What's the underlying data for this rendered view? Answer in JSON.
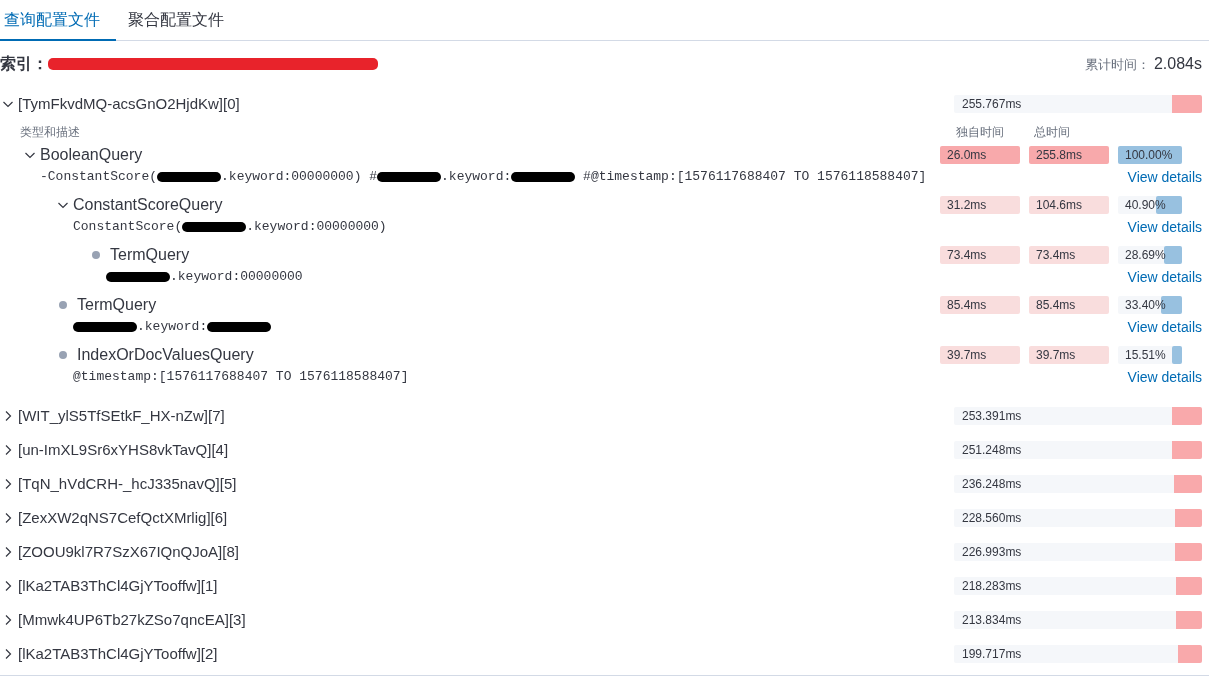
{
  "tabs": [
    {
      "label": "查询配置文件",
      "selected": true
    },
    {
      "label": "聚合配置文件",
      "selected": false
    }
  ],
  "index": {
    "label": "索引：",
    "value": [
      {
        "kind": "redaction",
        "color": "#e8232b"
      }
    ]
  },
  "cumulative": {
    "label": "累计时间：",
    "value": "2.084s"
  },
  "shards": [
    {
      "name": "[TymFkvdMQ-acsGnO2HjdKw][0]",
      "expanded": true,
      "time": "255.767ms",
      "level": 0.123,
      "columns": {
        "type": "类型和描述",
        "self": "独自时间",
        "total": "总时间"
      },
      "queries": [
        {
          "type": "BooleanQuery",
          "expanded": true,
          "description": [
            {
              "kind": "text",
              "text": "-ConstantScore("
            },
            {
              "kind": "redaction",
              "color": "#000000"
            },
            {
              "kind": "text",
              "text": ".keyword:00000000) #"
            },
            {
              "kind": "redaction",
              "color": "#000000"
            },
            {
              "kind": "text",
              "text": ".keyword:"
            },
            {
              "kind": "redaction",
              "color": "#000000"
            },
            {
              "kind": "text",
              "text": " #@timestamp:[1576117688407 TO 1576118588407]"
            }
          ],
          "self_time": {
            "text": "26.0ms",
            "color": "#f8a9ab"
          },
          "total_time": {
            "text": "255.8ms",
            "color": "#f8a9ab"
          },
          "percent": "100.00%",
          "level": 1,
          "link": "View details",
          "children": [
            {
              "type": "ConstantScoreQuery",
              "expanded": true,
              "description": [
                {
                  "kind": "text",
                  "text": "ConstantScore("
                },
                {
                  "kind": "redaction",
                  "color": "#000000"
                },
                {
                  "kind": "text",
                  "text": ".keyword:00000000)"
                }
              ],
              "self_time": {
                "text": "31.2ms",
                "color": "#f9dddd"
              },
              "total_time": {
                "text": "104.6ms",
                "color": "#f9dddd"
              },
              "percent": "40.90%",
              "level": 0.409,
              "link": "View details",
              "children": [
                {
                  "type": "TermQuery",
                  "description": [
                    {
                      "kind": "redaction",
                      "color": "#000000"
                    },
                    {
                      "kind": "text",
                      "text": ".keyword:00000000"
                    }
                  ],
                  "self_time": {
                    "text": "73.4ms",
                    "color": "#f9dddd"
                  },
                  "total_time": {
                    "text": "73.4ms",
                    "color": "#f9dddd"
                  },
                  "percent": "28.69%",
                  "level": 0.2869,
                  "link": "View details"
                }
              ]
            },
            {
              "type": "TermQuery",
              "description": [
                {
                  "kind": "redaction",
                  "color": "#000000"
                },
                {
                  "kind": "text",
                  "text": ".keyword:"
                },
                {
                  "kind": "redaction",
                  "color": "#000000"
                }
              ],
              "self_time": {
                "text": "85.4ms",
                "color": "#f9dddd"
              },
              "total_time": {
                "text": "85.4ms",
                "color": "#f9dddd"
              },
              "percent": "33.40%",
              "level": 0.334,
              "link": "View details"
            },
            {
              "type": "IndexOrDocValuesQuery",
              "description": [
                {
                  "kind": "text",
                  "text": "@timestamp:[1576117688407 TO 1576118588407]"
                }
              ],
              "self_time": {
                "text": "39.7ms",
                "color": "#f9dddd"
              },
              "total_time": {
                "text": "39.7ms",
                "color": "#f9dddd"
              },
              "percent": "15.51%",
              "level": 0.1551,
              "link": "View details"
            }
          ]
        }
      ]
    },
    {
      "name": "[WIT_ylS5TfSEtkF_HX-nZw][7]",
      "expanded": false,
      "time": "253.391ms",
      "level": 0.122
    },
    {
      "name": "[un-ImXL9Sr6xYHS8vkTavQ][4]",
      "expanded": false,
      "time": "251.248ms",
      "level": 0.121
    },
    {
      "name": "[TqN_hVdCRH-_hcJ335navQ][5]",
      "expanded": false,
      "time": "236.248ms",
      "level": 0.113
    },
    {
      "name": "[ZexXW2qNS7CefQctXMrlig][6]",
      "expanded": false,
      "time": "228.560ms",
      "level": 0.11
    },
    {
      "name": "[ZOOU9kl7R7SzX67IQnQJoA][8]",
      "expanded": false,
      "time": "226.993ms",
      "level": 0.109
    },
    {
      "name": "[lKa2TAB3ThCl4GjYTooffw][1]",
      "expanded": false,
      "time": "218.283ms",
      "level": 0.105
    },
    {
      "name": "[Mmwk4UP6Tb27kZSo7qncEA][3]",
      "expanded": false,
      "time": "213.834ms",
      "level": 0.103
    },
    {
      "name": "[lKa2TAB3ThCl4GjYTooffw][2]",
      "expanded": false,
      "time": "199.717ms",
      "level": 0.096
    }
  ]
}
